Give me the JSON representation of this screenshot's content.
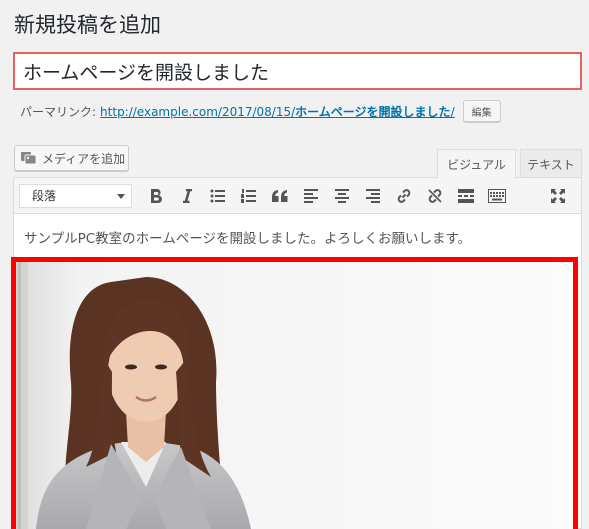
{
  "page": {
    "title": "新規投稿を追加"
  },
  "post": {
    "title_value": "ホームページを開設しました",
    "content_text": "サンプルPC教室のホームページを開設しました。よろしくお願いします。"
  },
  "permalink": {
    "label": "パーマリンク:",
    "url_base": "http://example.com/2017/08/15/",
    "url_slug": "ホームページを開設しました",
    "url_tail": "/",
    "edit_label": "編集"
  },
  "media": {
    "add_label": "メディアを追加",
    "icon": "media-icon"
  },
  "tabs": {
    "visual": "ビジュアル",
    "text": "テキスト"
  },
  "toolbar": {
    "format_value": "段落",
    "buttons": [
      "bold-icon",
      "italic-icon",
      "bullet-list-icon",
      "numbered-list-icon",
      "blockquote-icon",
      "align-left-icon",
      "align-center-icon",
      "align-right-icon",
      "link-icon",
      "unlink-icon",
      "read-more-icon",
      "toolbar-toggle-icon",
      "fullscreen-icon"
    ]
  },
  "colors": {
    "highlight": "#ff0000",
    "title_border": "#e8615f",
    "link": "#0073aa"
  }
}
